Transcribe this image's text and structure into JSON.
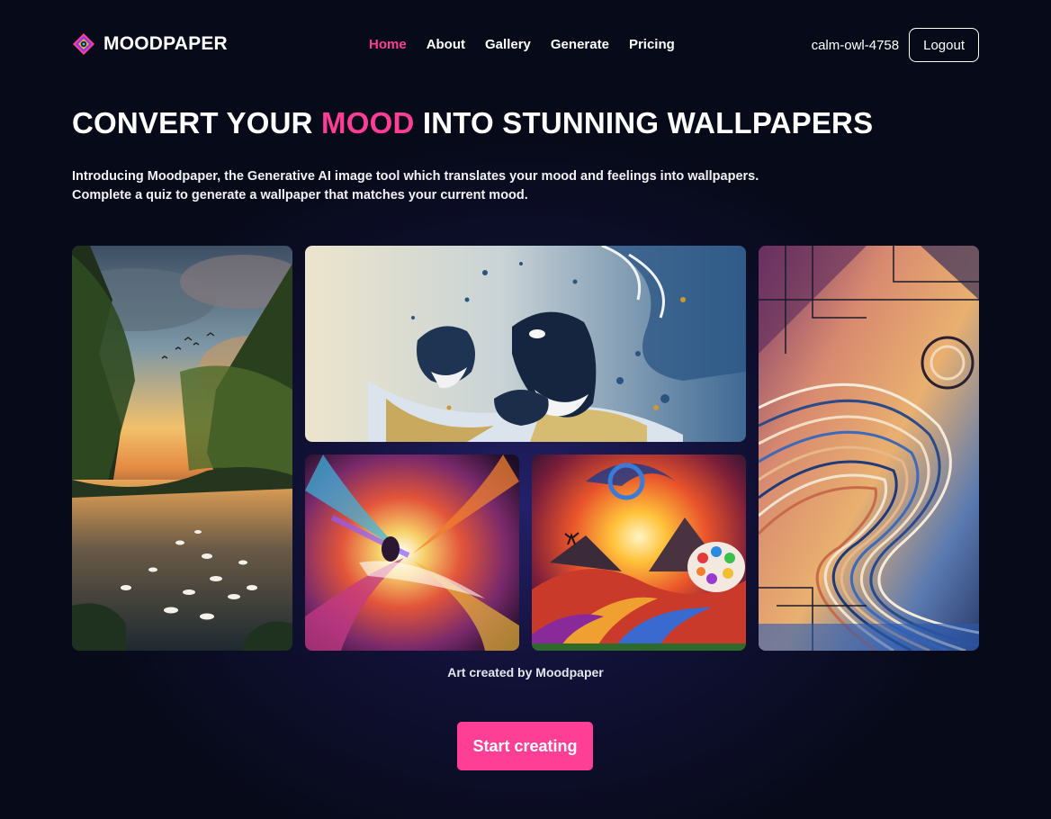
{
  "brand": {
    "name": "MOODPAPER",
    "icon": "moodpaper-logo-icon"
  },
  "nav": {
    "items": [
      {
        "label": "Home",
        "active": true
      },
      {
        "label": "About",
        "active": false
      },
      {
        "label": "Gallery",
        "active": false
      },
      {
        "label": "Generate",
        "active": false
      },
      {
        "label": "Pricing",
        "active": false
      }
    ]
  },
  "user": {
    "name": "calm-owl-4758",
    "logout_label": "Logout"
  },
  "hero": {
    "title_before": "CONVERT YOUR ",
    "title_accent": "MOOD",
    "title_after": " INTO STUNNING WALLPAPERS",
    "desc_line1": "Introducing Moodpaper, the Generative AI image tool which translates your mood and feelings into wallpapers.",
    "desc_line2": "Complete a quiz to generate a wallpaper that matches your current mood."
  },
  "gallery": {
    "caption": "Art created by Moodpaper",
    "images": [
      {
        "name": "sunset-river-swans"
      },
      {
        "name": "orca-whales-splash"
      },
      {
        "name": "abstract-color-explosion"
      },
      {
        "name": "mountain-sunburst-palette"
      },
      {
        "name": "geometric-line-waves"
      }
    ]
  },
  "cta": {
    "label": "Start creating"
  },
  "colors": {
    "accent": "#ff3f96",
    "background": "#070a18"
  }
}
